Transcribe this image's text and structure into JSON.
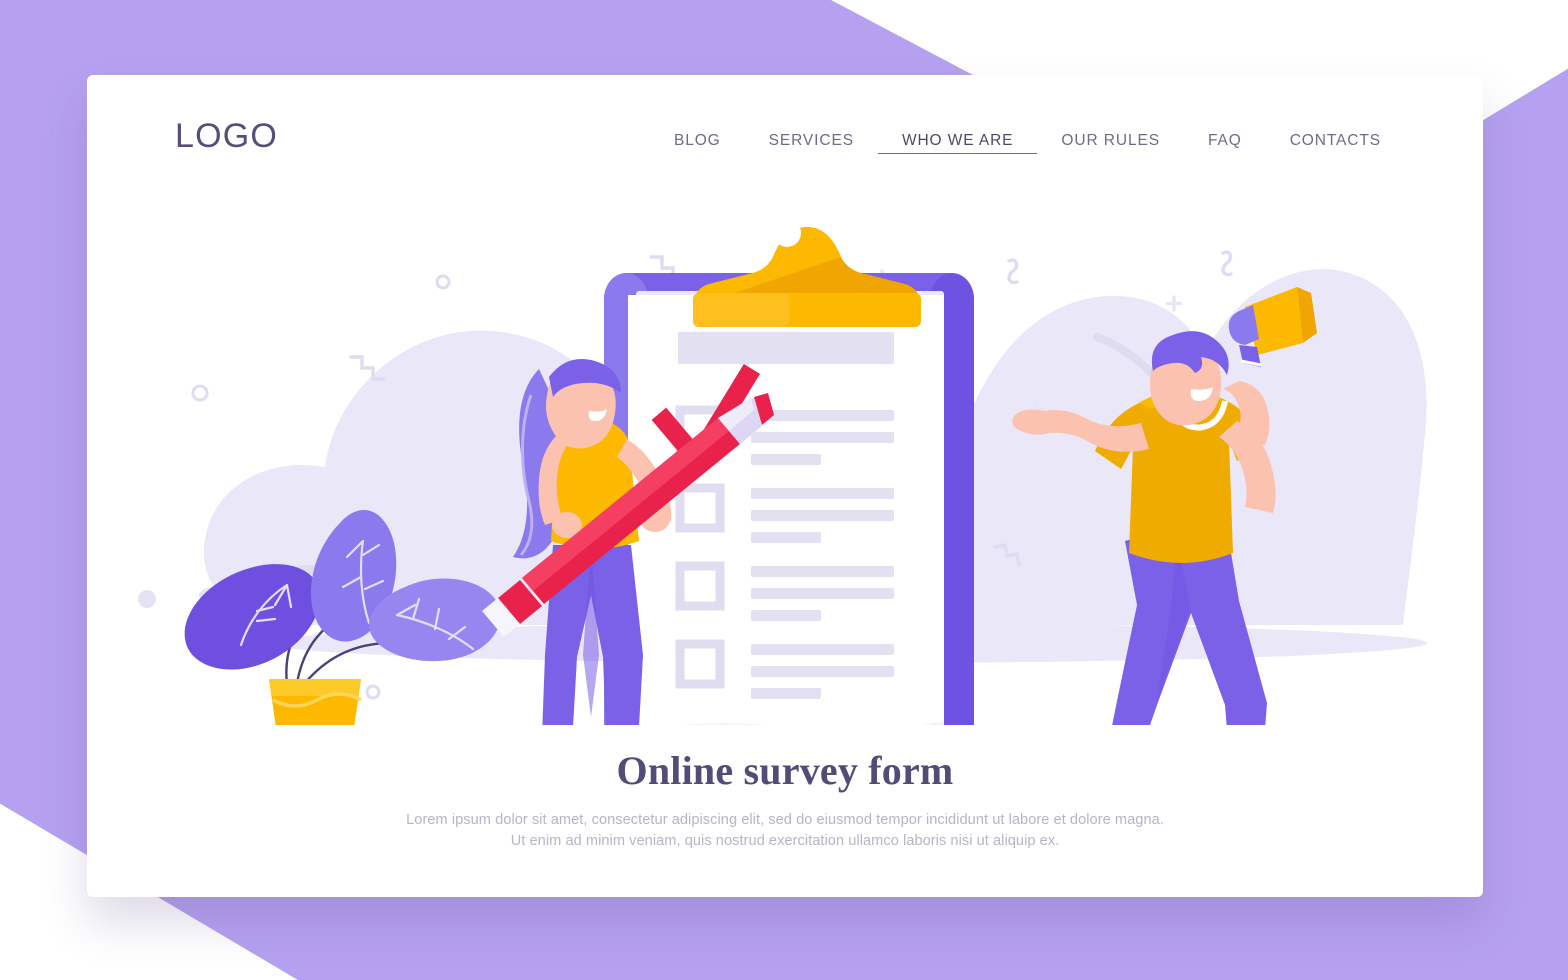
{
  "theme": {
    "page_background": "#b5a1f0",
    "card_background": "#ffffff",
    "logo_color": "#544f79",
    "nav_color": "#6e6b86",
    "headline_color": "#514d77",
    "body_text_color": "#b6b4c6",
    "accent_purple": "#7b61e8",
    "accent_purple_light": "#8b79ee",
    "accent_yellow": "#fcb900",
    "accent_yellow_dark": "#f0a500",
    "accent_red": "#e8224b",
    "blob_lavender": "#e9e7f8",
    "paper_white": "#ffffff",
    "paper_line": "#e3e1f1",
    "skin": "#fbc2b0"
  },
  "header": {
    "logo": "LOGO",
    "nav": [
      {
        "label": "BLOG",
        "active": false
      },
      {
        "label": "SERVICES",
        "active": false
      },
      {
        "label": "WHO WE ARE",
        "active": true
      },
      {
        "label": "OUR RULES",
        "active": false
      },
      {
        "label": "FAQ",
        "active": false
      },
      {
        "label": "CONTACTS",
        "active": false
      }
    ]
  },
  "hero": {
    "headline": "Online survey form",
    "paragraph_line_1": "Lorem ipsum dolor sit amet, consectetur adipiscing elit, sed do eiusmod tempor incididunt ut labore et dolore magna.",
    "paragraph_line_2": "Ut enim ad minim veniam, quis nostrud exercitation ullamco laboris nisi ut aliquip ex."
  },
  "illustration": {
    "description": "Flat illustration of a giant clipboard survey form with a woman holding a large red pencil on the left, a cheering man with a megaphone on the right, and a potted plant",
    "clipboard": {
      "board_color": "#7b61e8",
      "clip_color": "#fcb900",
      "title_block": true,
      "checklist_rows": 4,
      "checked_rows": [
        1
      ],
      "check_color": "#e8224b",
      "lines_per_row": 3
    },
    "characters": [
      {
        "name": "woman-with-pencil",
        "hair": "#7b61e8",
        "top": "#fcb900",
        "pants": "#7b61e8",
        "prop": "red-pencil"
      },
      {
        "name": "man-with-megaphone",
        "hair": "#7b61e8",
        "top": "#f0ab00",
        "pants": "#7b61e8",
        "prop": "yellow-megaphone"
      }
    ],
    "plant": {
      "leaf_color": "#7b61e8",
      "pot_color": "#fcb900"
    },
    "decorations": [
      "circle-outline",
      "zigzag",
      "plus",
      "dot",
      "arc"
    ]
  }
}
